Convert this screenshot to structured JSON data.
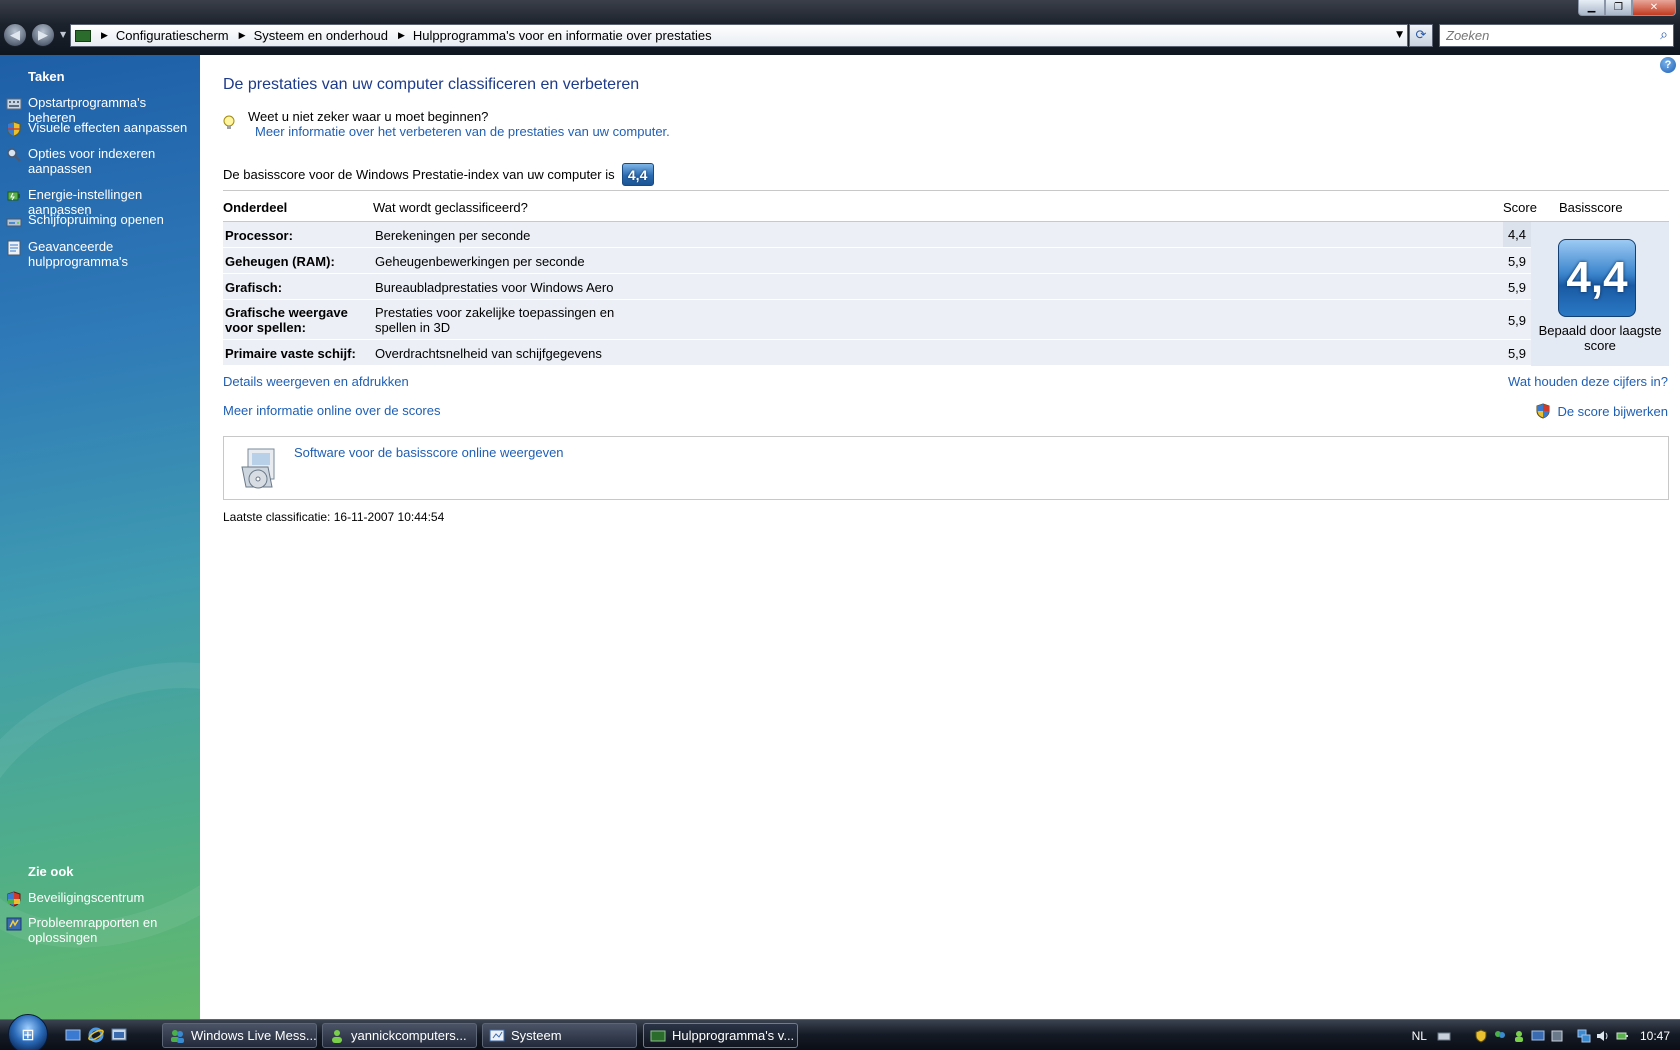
{
  "window": {
    "min_label": "▁",
    "max_label": "❐",
    "close_label": "✕"
  },
  "nav": {
    "back_glyph": "◀",
    "forward_glyph": "▶",
    "dropdown_glyph": "▼",
    "refresh_glyph": "⟳",
    "search_glyph": "⌕"
  },
  "breadcrumbs": [
    "Configuratiescherm",
    "Systeem en onderhoud",
    "Hulpprogramma's voor en informatie over prestaties"
  ],
  "search": {
    "placeholder": "Zoeken"
  },
  "sidebar": {
    "tasks_heading": "Taken",
    "tasks": [
      {
        "label": "Opstartprogramma's beheren",
        "icon": "startup-programs-icon"
      },
      {
        "label": "Visuele effecten aanpassen",
        "icon": "shield-icon"
      },
      {
        "label": "Opties voor indexeren aanpassen",
        "icon": "indexing-icon"
      },
      {
        "label": "Energie-instellingen aanpassen",
        "icon": "power-icon"
      },
      {
        "label": "Schijfopruiming openen",
        "icon": "disk-cleanup-icon"
      },
      {
        "label": "Geavanceerde hulpprogramma's",
        "icon": "advanced-tools-icon"
      }
    ],
    "see_also_heading": "Zie ook",
    "see_also": [
      {
        "label": "Beveiligingscentrum",
        "icon": "security-center-icon"
      },
      {
        "label": "Probleemrapporten en oplossingen",
        "icon": "problem-reports-icon"
      }
    ]
  },
  "main": {
    "help_label": "?",
    "title": "De prestaties van uw computer classificeren en verbeteren",
    "hint_question": "Weet u niet zeker waar u moet beginnen?",
    "hint_link": "Meer informatie over het verbeteren van de prestaties van uw computer.",
    "base_score_text": "De basisscore voor de Windows Prestatie-index van uw computer is",
    "base_score": "4,4",
    "table": {
      "headers": [
        "Onderdeel",
        "Wat wordt geclassificeerd?",
        "Score",
        "Basisscore"
      ],
      "rows": [
        {
          "component": "Processor:",
          "rated": "Berekeningen per seconde",
          "score": "4,4"
        },
        {
          "component": "Geheugen (RAM):",
          "rated": "Geheugenbewerkingen per seconde",
          "score": "5,9"
        },
        {
          "component": "Grafisch:",
          "rated": "Bureaubladprestaties voor Windows Aero",
          "score": "5,9"
        },
        {
          "component": "Grafische weergave voor spellen:",
          "rated": "Prestaties voor zakelijke toepassingen en spellen in 3D",
          "score": "5,9"
        },
        {
          "component": "Primaire vaste schijf:",
          "rated": "Overdrachtsnelheid van schijfgegevens",
          "score": "5,9"
        }
      ],
      "base_score_caption": "Bepaald door laagste score"
    },
    "links": {
      "details": "Details weergeven en afdrukken",
      "meaning": "Wat houden deze cijfers in?",
      "more_online": "Meer informatie online over de scores",
      "update_score": "De score bijwerken",
      "software_online": "Software voor de basisscore online weergeven"
    },
    "last_rating": "Laatste classificatie: 16-11-2007 10:44:54"
  },
  "taskbar": {
    "start_glyph": "⊞",
    "tasks": [
      {
        "label": "Windows Live Mess...",
        "active": false
      },
      {
        "label": "yannickcomputers...",
        "active": false
      },
      {
        "label": "Systeem",
        "active": false
      },
      {
        "label": "Hulpprogramma's v...",
        "active": true
      }
    ],
    "language": "NL",
    "clock": "10:47"
  }
}
